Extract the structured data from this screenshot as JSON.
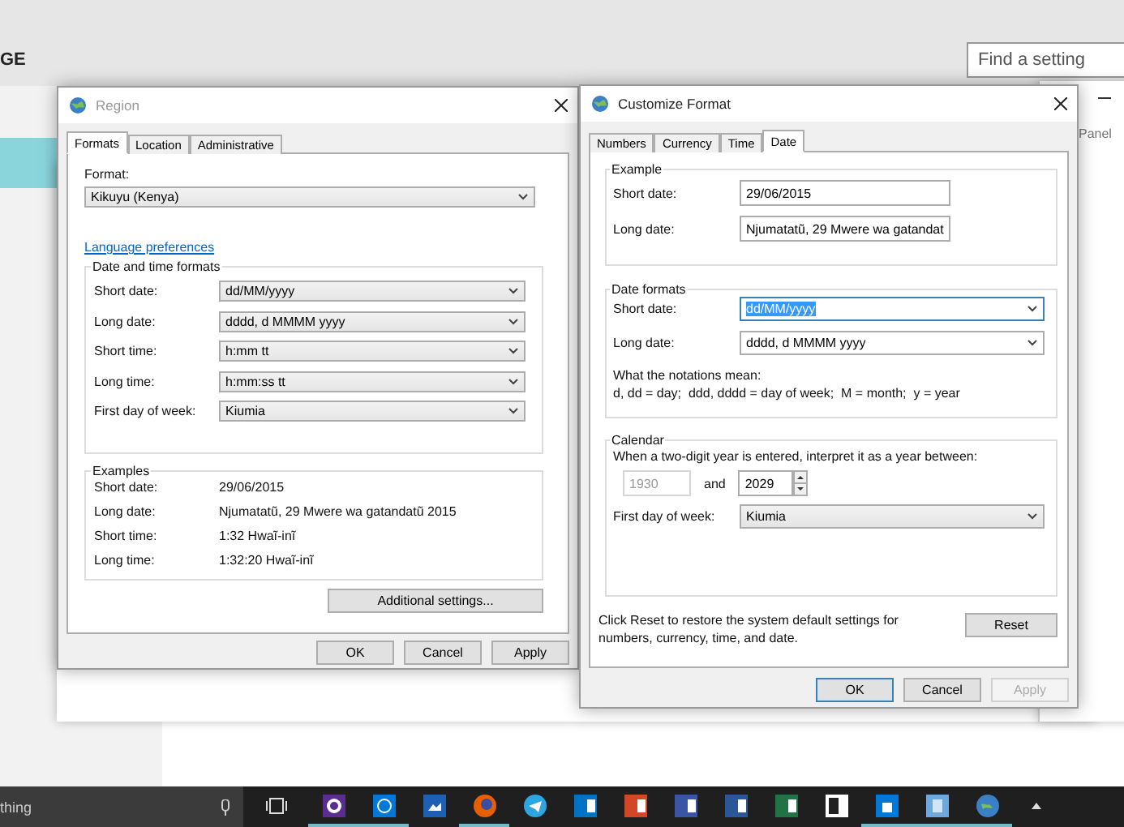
{
  "settings": {
    "heading": "GE",
    "search": {
      "placeholder": "Find a setting"
    },
    "sidebar": {
      "items": [
        {
          "selected": true
        }
      ]
    }
  },
  "background_window": {
    "title": "Panel"
  },
  "region_dialog": {
    "title": "Region",
    "tabs": [
      {
        "label": "Formats",
        "selected": true
      },
      {
        "label": "Location",
        "selected": false
      },
      {
        "label": "Administrative",
        "selected": false
      }
    ],
    "format": {
      "label": "Format:",
      "value": "Kikuyu (Kenya)"
    },
    "link": "Language preferences",
    "date_time_formats": {
      "legend": "Date and time formats",
      "rows": [
        {
          "label": "Short date:",
          "value": "dd/MM/yyyy"
        },
        {
          "label": "Long date:",
          "value": "dddd, d MMMM yyyy"
        },
        {
          "label": "Short time:",
          "value": "h:mm tt"
        },
        {
          "label": "Long time:",
          "value": "h:mm:ss tt"
        },
        {
          "label": "First day of week:",
          "value": "Kiumia"
        }
      ]
    },
    "examples": {
      "legend": "Examples",
      "rows": [
        {
          "label": "Short date:",
          "value": "29/06/2015"
        },
        {
          "label": "Long date:",
          "value": "Njumatatũ, 29 Mwere wa gatandatũ 2015"
        },
        {
          "label": "Short time:",
          "value": "1:32 Hwaĩ-inĩ"
        },
        {
          "label": "Long time:",
          "value": "1:32:20 Hwaĩ-inĩ"
        }
      ]
    },
    "additional_button": "Additional settings...",
    "buttons": [
      {
        "label": "OK",
        "default": false,
        "disabled": false
      },
      {
        "label": "Cancel",
        "default": false,
        "disabled": false
      },
      {
        "label": "Apply",
        "default": false,
        "disabled": false
      }
    ]
  },
  "customize_dialog": {
    "title": "Customize Format",
    "tabs": [
      {
        "label": "Numbers",
        "selected": false
      },
      {
        "label": "Currency",
        "selected": false
      },
      {
        "label": "Time",
        "selected": false
      },
      {
        "label": "Date",
        "selected": true
      }
    ],
    "example": {
      "legend": "Example",
      "rows": [
        {
          "label": "Short date:",
          "value": "29/06/2015"
        },
        {
          "label": "Long date:",
          "value": "Njumatatũ, 29 Mwere wa gatandat"
        }
      ]
    },
    "date_formats": {
      "legend": "Date formats",
      "rows": [
        {
          "label": "Short date:",
          "value": "dd/MM/yyyy",
          "highlighted": true
        },
        {
          "label": "Long date:",
          "value": "dddd, d MMMM yyyy",
          "highlighted": false
        }
      ],
      "notation_title": "What the notations mean:",
      "notation_text": "d, dd = day;  ddd, dddd = day of week;  M = month;  y = year"
    },
    "calendar": {
      "legend": "Calendar",
      "intro": "When a two-digit year is entered, interpret it as a year between:",
      "from": {
        "value": "1930",
        "disabled": true
      },
      "and": "and",
      "to": {
        "value": "2029",
        "disabled": false
      },
      "first_day": {
        "label": "First day of week:",
        "value": "Kiumia"
      }
    },
    "reset_note": "Click Reset to restore the system default settings for numbers, currency, time, and date.",
    "reset_button": "Reset",
    "buttons": [
      {
        "label": "OK",
        "default": true,
        "disabled": false
      },
      {
        "label": "Cancel",
        "default": false,
        "disabled": false
      },
      {
        "label": "Apply",
        "default": false,
        "disabled": true
      }
    ]
  },
  "taskbar": {
    "search_text": "thing",
    "apps": [
      {
        "kind": "settings",
        "running": true
      },
      {
        "kind": "globe",
        "running": true
      },
      {
        "kind": "photo",
        "running": false
      },
      {
        "kind": "firefox",
        "running": true
      },
      {
        "kind": "telegram",
        "running": false
      },
      {
        "kind": "outlook",
        "running": false
      },
      {
        "kind": "powerpoint",
        "running": false
      },
      {
        "kind": "visio",
        "running": false
      },
      {
        "kind": "word",
        "running": false
      },
      {
        "kind": "excel",
        "running": false
      },
      {
        "kind": "onenote",
        "running": false
      },
      {
        "kind": "store",
        "running": true
      },
      {
        "kind": "control-panel",
        "running": true
      },
      {
        "kind": "region",
        "running": true
      }
    ]
  }
}
